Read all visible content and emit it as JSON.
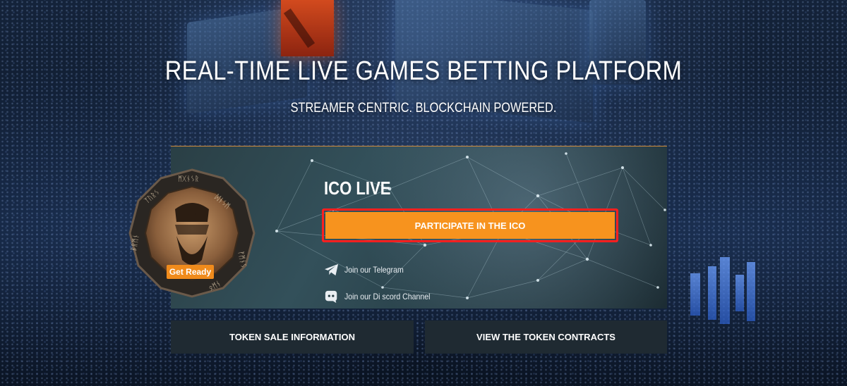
{
  "hero": {
    "title": "REAL-TIME LIVE GAMES BETTING PLATFORM",
    "subtitle": "STREAMER CENTRIC. BLOCKCHAIN POWERED."
  },
  "ico_panel": {
    "heading": "ICO LIVE",
    "participate_label": "PARTICIPATE IN THE ICO",
    "badge_label": "Get Ready",
    "links": {
      "telegram_label": "Join our Telegram",
      "discord_label": "Join our Di scord Channel"
    }
  },
  "actions": {
    "token_sale_label": "TOKEN SALE INFORMATION",
    "contracts_label": "VIEW THE TOKEN CONTRACTS"
  },
  "colors": {
    "accent": "#f7931e",
    "highlight_border": "#ff1f1f",
    "dark_button": "#1f2a32"
  },
  "icons": [
    "coin-emblem",
    "telegram-icon",
    "discord-icon"
  ]
}
